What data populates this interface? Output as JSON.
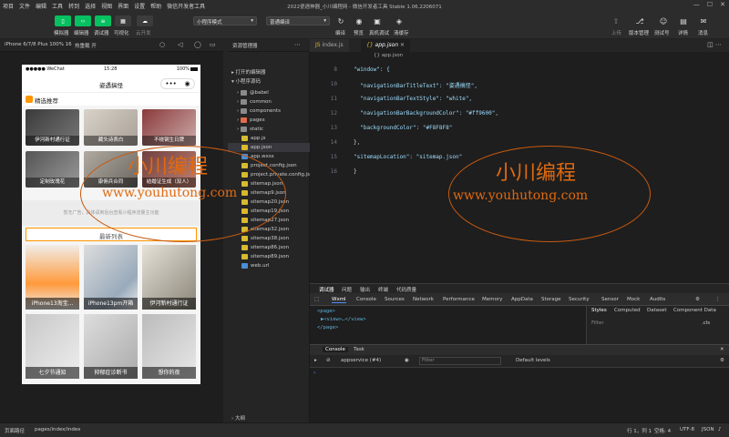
{
  "menu": [
    "项目",
    "文件",
    "编辑",
    "工具",
    "转到",
    "选择",
    "视图",
    "界面",
    "设置",
    "帮助",
    "微信开发者工具"
  ],
  "window_title": "2022瓷遇神器_小川编程网 - 微信开发者工具 Stable 1.06.2206071",
  "toolbar": {
    "left_buttons": [
      "模拟器",
      "编辑器",
      "调试器",
      "可视化",
      "云开发"
    ],
    "mode_select": "小程序模式",
    "compile_select": "普通编译",
    "center_actions": [
      "编译",
      "预览",
      "真机调试",
      "清缓存"
    ],
    "right_actions": [
      "上传",
      "版本管理",
      "测试号",
      "详情",
      "消息"
    ]
  },
  "subbar": {
    "device": "iPhone 6/7/8 Plus 100% 16",
    "hot_reload": "热重载 开",
    "explorer_title": "资源管理器"
  },
  "phone": {
    "status_left": "●●●●● WeChat",
    "status_time": "15:28",
    "status_right": "100%",
    "nav_title": "姿遇搞怪",
    "section_title": "精选推荐",
    "grid": [
      "伊河新村通行证",
      "藏头诗表白",
      "不绕钢生日牌",
      "定制玫瑰花",
      "康佣兵合同",
      "结婚证生成（双人）"
    ],
    "ad_text": "暂无广告，具体请到后台查看小程序流量主功能",
    "latest_title": "最新列表",
    "news": [
      "iPhone13淘宝...",
      "iPhone13pm开箱",
      "伊河新村通行证",
      "七夕节通知",
      "抑郁症诊断书",
      "想你的夜"
    ]
  },
  "explorer": {
    "open_editors": "打开的编辑器",
    "root": "小程序源码",
    "items": [
      "@babel",
      "common",
      "components",
      "pages",
      "static",
      "app.js",
      "app.json",
      "app.wxss",
      "project.config.json",
      "project.private.config.js...",
      "sitemap.json",
      "sitemap9.json",
      "sitemap20.json",
      "sitemap19.json",
      "sitemap27.json",
      "sitemap32.json",
      "sitemap38.json",
      "sitemap86.json",
      "sitemap89.json",
      "web.url"
    ],
    "outline": "大纲"
  },
  "editor": {
    "tabs": [
      "index.js",
      "app.json"
    ],
    "breadcrumb": "{} app.json",
    "lines": [
      {
        "n": "8",
        "t": "\"window\": {"
      },
      {
        "n": "10",
        "t": "  \"navigationBarTitleText\": \"姿遇搞怪\","
      },
      {
        "n": "11",
        "t": "  \"navigationBarTextStyle\": \"white\","
      },
      {
        "n": "12",
        "t": "  \"navigationBarBackgroundColor\": \"#ff9600\","
      },
      {
        "n": "13",
        "t": "  \"backgroundColor\": \"#F8F8F8\""
      },
      {
        "n": "14",
        "t": "},"
      },
      {
        "n": "15",
        "t": "\"sitemapLocation\": \"sitemap.json\""
      },
      {
        "n": "16",
        "t": "}"
      }
    ]
  },
  "debugger": {
    "top_tabs": [
      "调试器",
      "问题",
      "输出",
      "终端",
      "代码质量"
    ],
    "tabs": [
      "Wxml",
      "Console",
      "Sources",
      "Network",
      "Performance",
      "Memory",
      "AppData",
      "Storage",
      "Security",
      "Sensor",
      "Mock",
      "Audits"
    ],
    "tree": [
      "<page>",
      "▶<view>…</view>",
      "</page>"
    ],
    "style_tabs": [
      "Styles",
      "Computed",
      "Dataset",
      "Component Data"
    ],
    "filter": "Filter",
    "cls": ".cls",
    "console_tabs": [
      "Console",
      "Task"
    ],
    "context": "appservice (#4)",
    "console_filter": "Filter",
    "levels": "Default levels"
  },
  "statusbar": {
    "left": "页面路径",
    "path": "pages/index/index",
    "cursor": "行 1，列 1",
    "spaces": "空格: 4",
    "encoding": "UTF-8",
    "lang": "JSON"
  },
  "watermark": {
    "cn": "小川编程",
    "en": "www.youhutong.com"
  },
  "colors": {
    "accent": "#07c160",
    "orange": "#ff9600"
  }
}
